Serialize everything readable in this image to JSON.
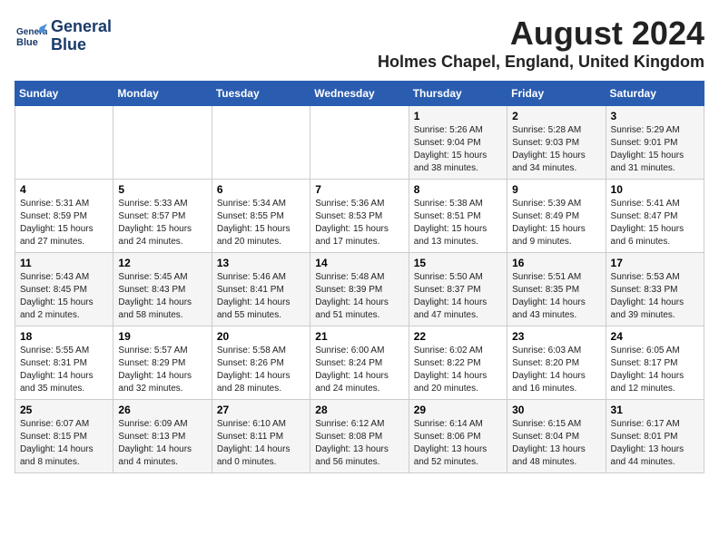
{
  "header": {
    "logo_line1": "General",
    "logo_line2": "Blue",
    "month": "August 2024",
    "location": "Holmes Chapel, England, United Kingdom"
  },
  "days_of_week": [
    "Sunday",
    "Monday",
    "Tuesday",
    "Wednesday",
    "Thursday",
    "Friday",
    "Saturday"
  ],
  "weeks": [
    [
      {
        "day": "",
        "info": ""
      },
      {
        "day": "",
        "info": ""
      },
      {
        "day": "",
        "info": ""
      },
      {
        "day": "",
        "info": ""
      },
      {
        "day": "1",
        "info": "Sunrise: 5:26 AM\nSunset: 9:04 PM\nDaylight: 15 hours\nand 38 minutes."
      },
      {
        "day": "2",
        "info": "Sunrise: 5:28 AM\nSunset: 9:03 PM\nDaylight: 15 hours\nand 34 minutes."
      },
      {
        "day": "3",
        "info": "Sunrise: 5:29 AM\nSunset: 9:01 PM\nDaylight: 15 hours\nand 31 minutes."
      }
    ],
    [
      {
        "day": "4",
        "info": "Sunrise: 5:31 AM\nSunset: 8:59 PM\nDaylight: 15 hours\nand 27 minutes."
      },
      {
        "day": "5",
        "info": "Sunrise: 5:33 AM\nSunset: 8:57 PM\nDaylight: 15 hours\nand 24 minutes."
      },
      {
        "day": "6",
        "info": "Sunrise: 5:34 AM\nSunset: 8:55 PM\nDaylight: 15 hours\nand 20 minutes."
      },
      {
        "day": "7",
        "info": "Sunrise: 5:36 AM\nSunset: 8:53 PM\nDaylight: 15 hours\nand 17 minutes."
      },
      {
        "day": "8",
        "info": "Sunrise: 5:38 AM\nSunset: 8:51 PM\nDaylight: 15 hours\nand 13 minutes."
      },
      {
        "day": "9",
        "info": "Sunrise: 5:39 AM\nSunset: 8:49 PM\nDaylight: 15 hours\nand 9 minutes."
      },
      {
        "day": "10",
        "info": "Sunrise: 5:41 AM\nSunset: 8:47 PM\nDaylight: 15 hours\nand 6 minutes."
      }
    ],
    [
      {
        "day": "11",
        "info": "Sunrise: 5:43 AM\nSunset: 8:45 PM\nDaylight: 15 hours\nand 2 minutes."
      },
      {
        "day": "12",
        "info": "Sunrise: 5:45 AM\nSunset: 8:43 PM\nDaylight: 14 hours\nand 58 minutes."
      },
      {
        "day": "13",
        "info": "Sunrise: 5:46 AM\nSunset: 8:41 PM\nDaylight: 14 hours\nand 55 minutes."
      },
      {
        "day": "14",
        "info": "Sunrise: 5:48 AM\nSunset: 8:39 PM\nDaylight: 14 hours\nand 51 minutes."
      },
      {
        "day": "15",
        "info": "Sunrise: 5:50 AM\nSunset: 8:37 PM\nDaylight: 14 hours\nand 47 minutes."
      },
      {
        "day": "16",
        "info": "Sunrise: 5:51 AM\nSunset: 8:35 PM\nDaylight: 14 hours\nand 43 minutes."
      },
      {
        "day": "17",
        "info": "Sunrise: 5:53 AM\nSunset: 8:33 PM\nDaylight: 14 hours\nand 39 minutes."
      }
    ],
    [
      {
        "day": "18",
        "info": "Sunrise: 5:55 AM\nSunset: 8:31 PM\nDaylight: 14 hours\nand 35 minutes."
      },
      {
        "day": "19",
        "info": "Sunrise: 5:57 AM\nSunset: 8:29 PM\nDaylight: 14 hours\nand 32 minutes."
      },
      {
        "day": "20",
        "info": "Sunrise: 5:58 AM\nSunset: 8:26 PM\nDaylight: 14 hours\nand 28 minutes."
      },
      {
        "day": "21",
        "info": "Sunrise: 6:00 AM\nSunset: 8:24 PM\nDaylight: 14 hours\nand 24 minutes."
      },
      {
        "day": "22",
        "info": "Sunrise: 6:02 AM\nSunset: 8:22 PM\nDaylight: 14 hours\nand 20 minutes."
      },
      {
        "day": "23",
        "info": "Sunrise: 6:03 AM\nSunset: 8:20 PM\nDaylight: 14 hours\nand 16 minutes."
      },
      {
        "day": "24",
        "info": "Sunrise: 6:05 AM\nSunset: 8:17 PM\nDaylight: 14 hours\nand 12 minutes."
      }
    ],
    [
      {
        "day": "25",
        "info": "Sunrise: 6:07 AM\nSunset: 8:15 PM\nDaylight: 14 hours\nand 8 minutes."
      },
      {
        "day": "26",
        "info": "Sunrise: 6:09 AM\nSunset: 8:13 PM\nDaylight: 14 hours\nand 4 minutes."
      },
      {
        "day": "27",
        "info": "Sunrise: 6:10 AM\nSunset: 8:11 PM\nDaylight: 14 hours\nand 0 minutes."
      },
      {
        "day": "28",
        "info": "Sunrise: 6:12 AM\nSunset: 8:08 PM\nDaylight: 13 hours\nand 56 minutes."
      },
      {
        "day": "29",
        "info": "Sunrise: 6:14 AM\nSunset: 8:06 PM\nDaylight: 13 hours\nand 52 minutes."
      },
      {
        "day": "30",
        "info": "Sunrise: 6:15 AM\nSunset: 8:04 PM\nDaylight: 13 hours\nand 48 minutes."
      },
      {
        "day": "31",
        "info": "Sunrise: 6:17 AM\nSunset: 8:01 PM\nDaylight: 13 hours\nand 44 minutes."
      }
    ]
  ]
}
